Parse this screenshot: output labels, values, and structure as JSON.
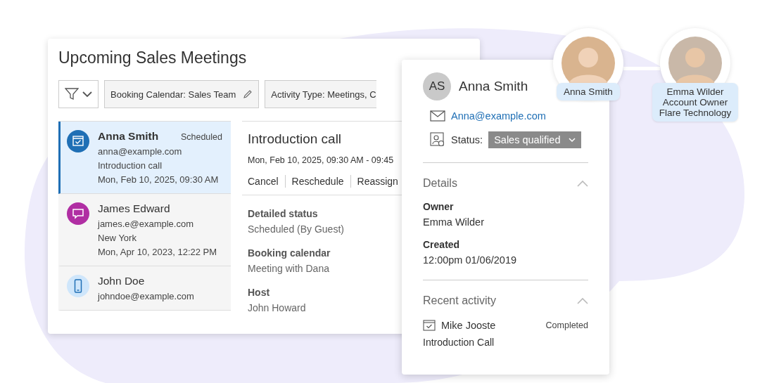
{
  "title": "Upcoming Sales Meetings",
  "filters": [
    {
      "label": "Booking Calendar: Sales Team",
      "editable": true
    },
    {
      "label": "Activity Type: Meetings, C",
      "editable": false
    }
  ],
  "meetings": [
    {
      "kind": "calendar",
      "color": "#1f6fb5",
      "name": "Anna Smith",
      "status": "Scheduled",
      "lines": [
        "anna@example.com",
        "Introduction call",
        "Mon, Feb 10, 2025, 09:30 AM"
      ],
      "selected": true
    },
    {
      "kind": "chat",
      "color": "#b02ea3",
      "name": "James Edward",
      "lines": [
        "james.e@example.com",
        "New York",
        "Mon, Apr 10, 2023, 12:22 PM"
      ],
      "selected": false
    },
    {
      "kind": "phone",
      "color": "#cfe6fb",
      "name": "John Doe",
      "lines": [
        "johndoe@example.com"
      ],
      "selected": false
    }
  ],
  "detail": {
    "title": "Introduction call",
    "time": "Mon, Feb 10, 2025, 09:30 AM - 09:45",
    "actions": [
      "Cancel",
      "Reschedule",
      "Reassign"
    ],
    "fields": [
      {
        "label": "Detailed status",
        "value": "Scheduled (By Guest)"
      },
      {
        "label": "Booking calendar",
        "value": "Meeting with Dana"
      },
      {
        "label": "Host",
        "value": "John Howard"
      }
    ]
  },
  "contact": {
    "initials": "AS",
    "name": "Anna Smith",
    "email": "Anna@example.com",
    "status_label": "Status:",
    "status": "Sales qualified",
    "details": {
      "title": "Details",
      "expanded": true,
      "fields": [
        {
          "label": "Owner",
          "value": "Emma Wilder"
        },
        {
          "label": "Created",
          "value": "12:00pm  01/06/2019"
        }
      ]
    },
    "activity": {
      "title": "Recent activity",
      "expanded": true,
      "items": [
        {
          "name": "Mike Jooste",
          "status": "Completed",
          "subject": "Introduction Call"
        }
      ]
    }
  },
  "people": [
    {
      "name": "Anna Smith"
    },
    {
      "name": "Emma Wilder",
      "lines": [
        "Account Owner",
        "Flare Technology"
      ]
    }
  ]
}
